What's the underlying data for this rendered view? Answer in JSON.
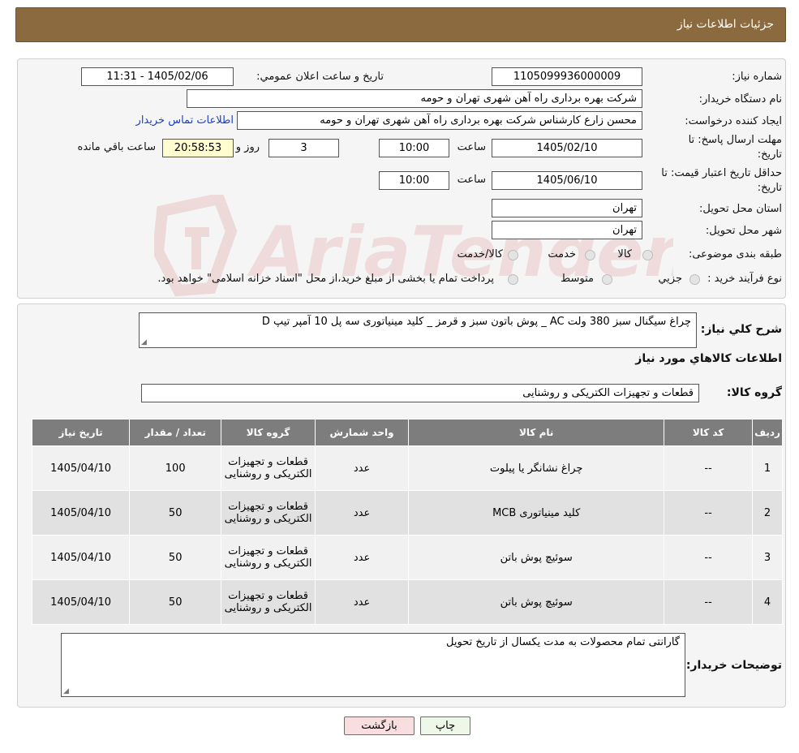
{
  "header": {
    "title": "جزئیات اطلاعات نیاز"
  },
  "info": {
    "need_number_label": "شماره نیاز:",
    "need_number": "1105099936000009",
    "announce_label": "تاريخ و ساعت اعلان عمومي:",
    "announce_value": "1405/02/06 - 11:31",
    "buyer_org_label": "نام دستگاه خريدار:",
    "buyer_org": "شرکت بهره برداری راه آهن شهری تهران و حومه",
    "creator_label": "ايجاد کننده درخواست:",
    "creator": "محسن زارع کارشناس شرکت بهره برداری راه آهن شهری تهران و حومه",
    "contact_link": "اطلاعات تماس خريدار",
    "deadline_label_1": "مهلت ارسال پاسخ: تا",
    "deadline_label_2": "تاريخ:",
    "deadline_date": "1405/02/10",
    "time_label": "ساعت",
    "deadline_time": "10:00",
    "days_value": "3",
    "days_label": "روز و",
    "remaining_time": "20:58:53",
    "remaining_label": "ساعت باقي مانده",
    "validity_label_1": "حداقل تاريخ اعتبار قيمت: تا",
    "validity_label_2": "تاريخ:",
    "validity_date": "1405/06/10",
    "validity_time": "10:00",
    "province_label": "استان محل تحويل:",
    "province": "تهران",
    "city_label": "شهر محل تحويل:",
    "city": "تهران",
    "category_label": "طبقه بندی موضوعی:",
    "category_options": [
      "کالا",
      "خدمت",
      "کالا/خدمت"
    ],
    "process_label": "نوع فرآيند خريد :",
    "process_options": [
      "جزيي",
      "متوسط"
    ],
    "process_note": "پرداخت تمام يا بخشی از مبلغ خريد،از محل \"اسناد خزانه اسلامی\" خواهد بود."
  },
  "summary": {
    "desc_label": "شرح کلي نياز:",
    "desc": "چراغ سیگنال سبز 380 ولت AC _ پوش باتون سبز و قرمز _ کلید مینیاتوری سه پل 10 آمپر تیپ D",
    "goods_info_title": "اطلاعات کالاهاي مورد نياز",
    "group_label": "گروه کالا:",
    "group": "قطعات و تجهیزات الکتریکی و روشنایی"
  },
  "table": {
    "headers": [
      "رديف",
      "کد کالا",
      "نام کالا",
      "واحد شمارش",
      "گروه کالا",
      "تعداد / مقدار",
      "تاريخ نياز"
    ],
    "rows": [
      {
        "idx": "1",
        "code": "--",
        "name": "چراغ نشانگر یا پیلوت",
        "unit": "عدد",
        "group": "قطعات و تجهیزات الکتریکی و روشنایی",
        "qty": "100",
        "date": "1405/04/10"
      },
      {
        "idx": "2",
        "code": "--",
        "name": "کلید مینیاتوری MCB",
        "unit": "عدد",
        "group": "قطعات و تجهیزات الکتریکی و روشنایی",
        "qty": "50",
        "date": "1405/04/10"
      },
      {
        "idx": "3",
        "code": "--",
        "name": "سوئیچ پوش باتن",
        "unit": "عدد",
        "group": "قطعات و تجهیزات الکتریکی و روشنایی",
        "qty": "50",
        "date": "1405/04/10"
      },
      {
        "idx": "4",
        "code": "--",
        "name": "سوئیچ پوش باتن",
        "unit": "عدد",
        "group": "قطعات و تجهیزات الکتریکی و روشنایی",
        "qty": "50",
        "date": "1405/04/10"
      }
    ]
  },
  "notes": {
    "label": "توضيحات خريدار:",
    "text": "گارانتی تمام محصولات به مدت یکسال از تاریخ تحویل"
  },
  "buttons": {
    "print": "چاپ",
    "back": "بازگشت"
  },
  "watermark": {
    "text": "AriaTender.neT"
  },
  "colors": {
    "header_bg": "#8b6a3f",
    "table_header_bg": "#7d7d7d",
    "link": "#1c3fbf",
    "back_button_bg": "#f8dede",
    "print_button_bg": "#eef8e8",
    "remaining_bg": "#fffccf"
  }
}
